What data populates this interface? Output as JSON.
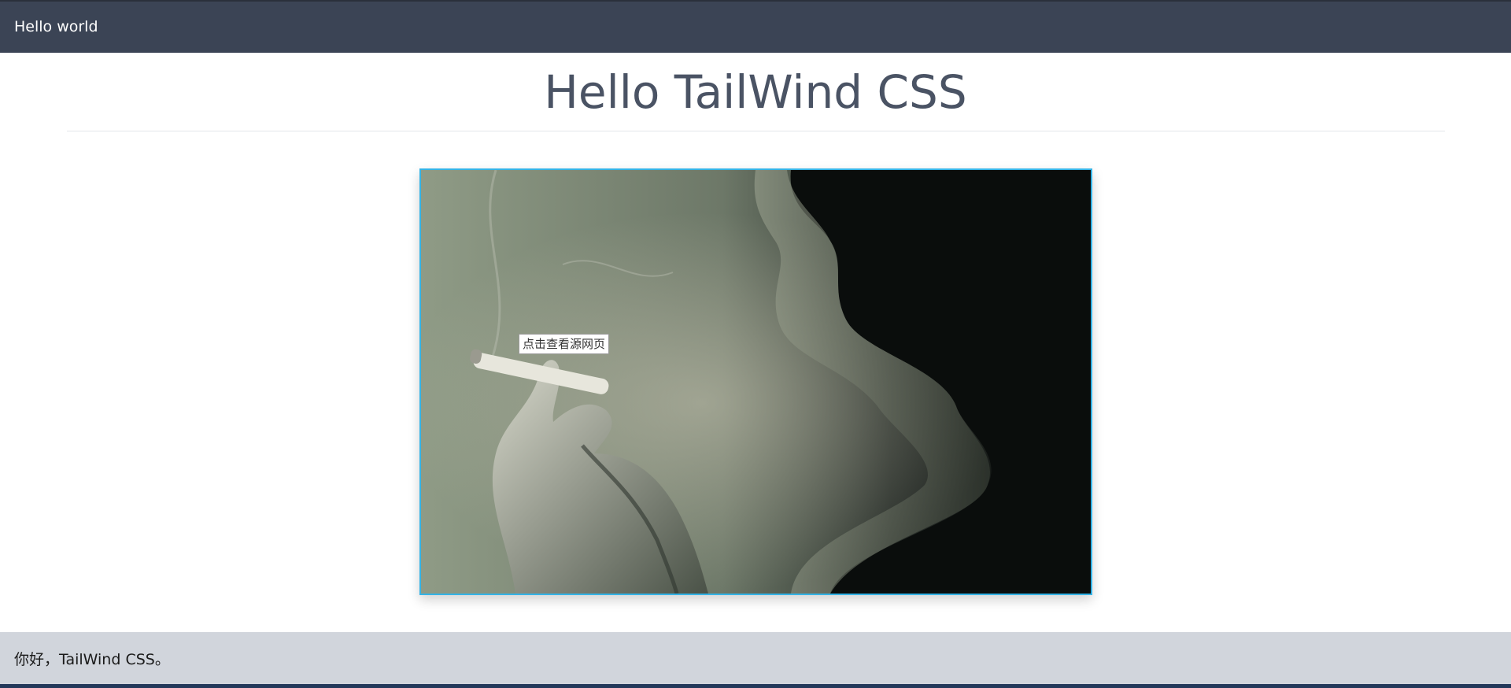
{
  "topbar": {
    "title": "Hello world"
  },
  "main": {
    "heading": "Hello TailWind CSS",
    "image": {
      "tooltip": "点击查看源网页"
    }
  },
  "footer": {
    "text": "你好，TailWind CSS。"
  },
  "colors": {
    "topbar_bg": "#3b4455",
    "heading_text": "#4a5364",
    "image_border": "#34b3e6",
    "footer_bg": "#d1d5dc"
  },
  "icons": []
}
